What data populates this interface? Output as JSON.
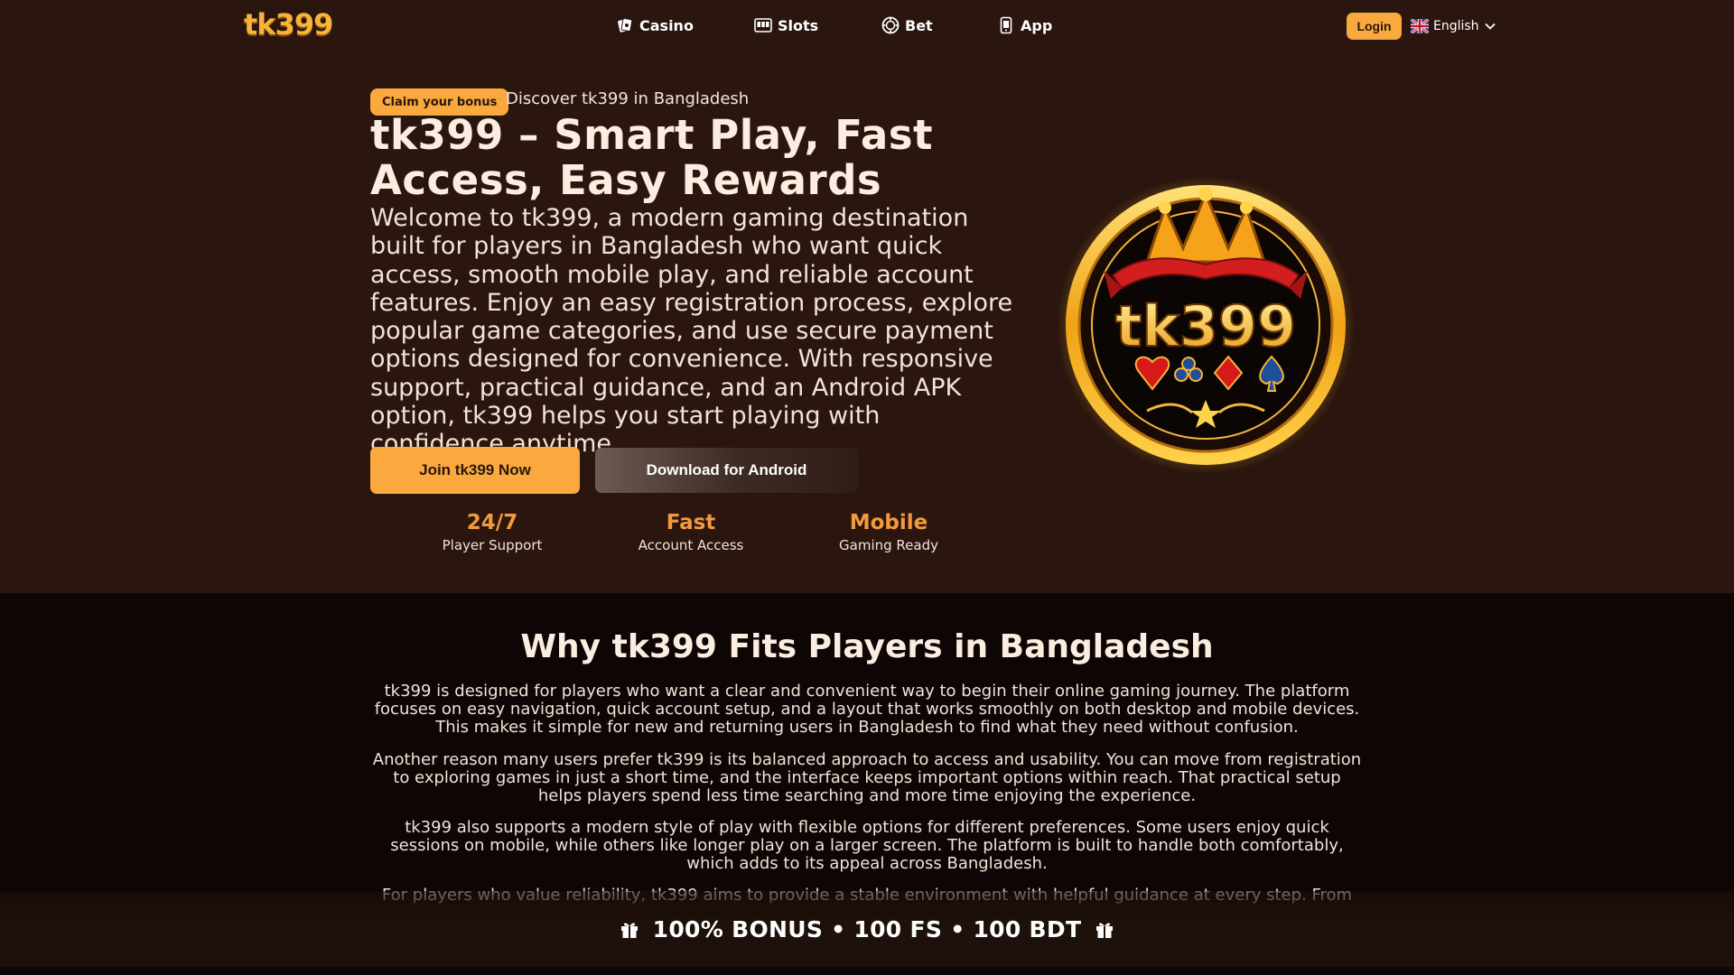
{
  "header": {
    "logo": "tk399",
    "nav": [
      {
        "label": "Casino",
        "icon": "casino-cards-icon"
      },
      {
        "label": "Slots",
        "icon": "slot-machine-icon"
      },
      {
        "label": "Bet",
        "icon": "chip-icon"
      },
      {
        "label": "App",
        "icon": "phone-icon"
      }
    ],
    "login_label": "Login",
    "language": "English"
  },
  "hero": {
    "badge": "Claim your bonus",
    "badge_text": "Discover tk399 in Bangladesh",
    "title": "tk399 – Smart Play, Fast Access, Easy Rewards",
    "description": "Welcome to tk399, a modern gaming destination built for players in Bangladesh who want quick access, smooth mobile play, and reliable account features. Enjoy an easy registration process, explore popular game categories, and use secure payment options designed for convenience. With responsive support, practical guidance, and an Android APK option, tk399 helps you start playing with confidence anytime.",
    "join_label": "Join tk399 Now",
    "android_label": "Download for Android",
    "stats": [
      {
        "value": "24/7",
        "label": "Player Support"
      },
      {
        "value": "Fast",
        "label": "Account Access"
      },
      {
        "value": "Mobile",
        "label": "Gaming Ready"
      }
    ],
    "emblem_text": "tk399"
  },
  "why": {
    "title": "Why tk399 Fits Players in Bangladesh",
    "paragraphs": [
      "tk399 is designed for players who want a clear and convenient way to begin their online gaming journey. The platform focuses on easy navigation, quick account setup, and a layout that works smoothly on both desktop and mobile devices. This makes it simple for new and returning users in Bangladesh to find what they need without confusion.",
      "Another reason many users prefer tk399 is its balanced approach to access and usability. You can move from registration to exploring games in just a short time, and the interface keeps important options within reach. That practical setup helps players spend less time searching and more time enjoying the experience.",
      "tk399 also supports a modern style of play with flexible options for different preferences. Some users enjoy quick sessions on mobile, while others like longer play on a larger screen. The platform is built to handle both comfortably, which adds to its appeal across Bangladesh.",
      "For players who value reliability, tk399 aims to provide a stable environment with helpful guidance at every step. From"
    ]
  },
  "bonus_bar": {
    "text": "100% BONUS • 100 FS • 100 BDT"
  },
  "colors": {
    "accent": "#f9a93d",
    "header_bg": "#2a160f",
    "page_bg": "#0d0605",
    "stat_value": "#f39a3c"
  }
}
